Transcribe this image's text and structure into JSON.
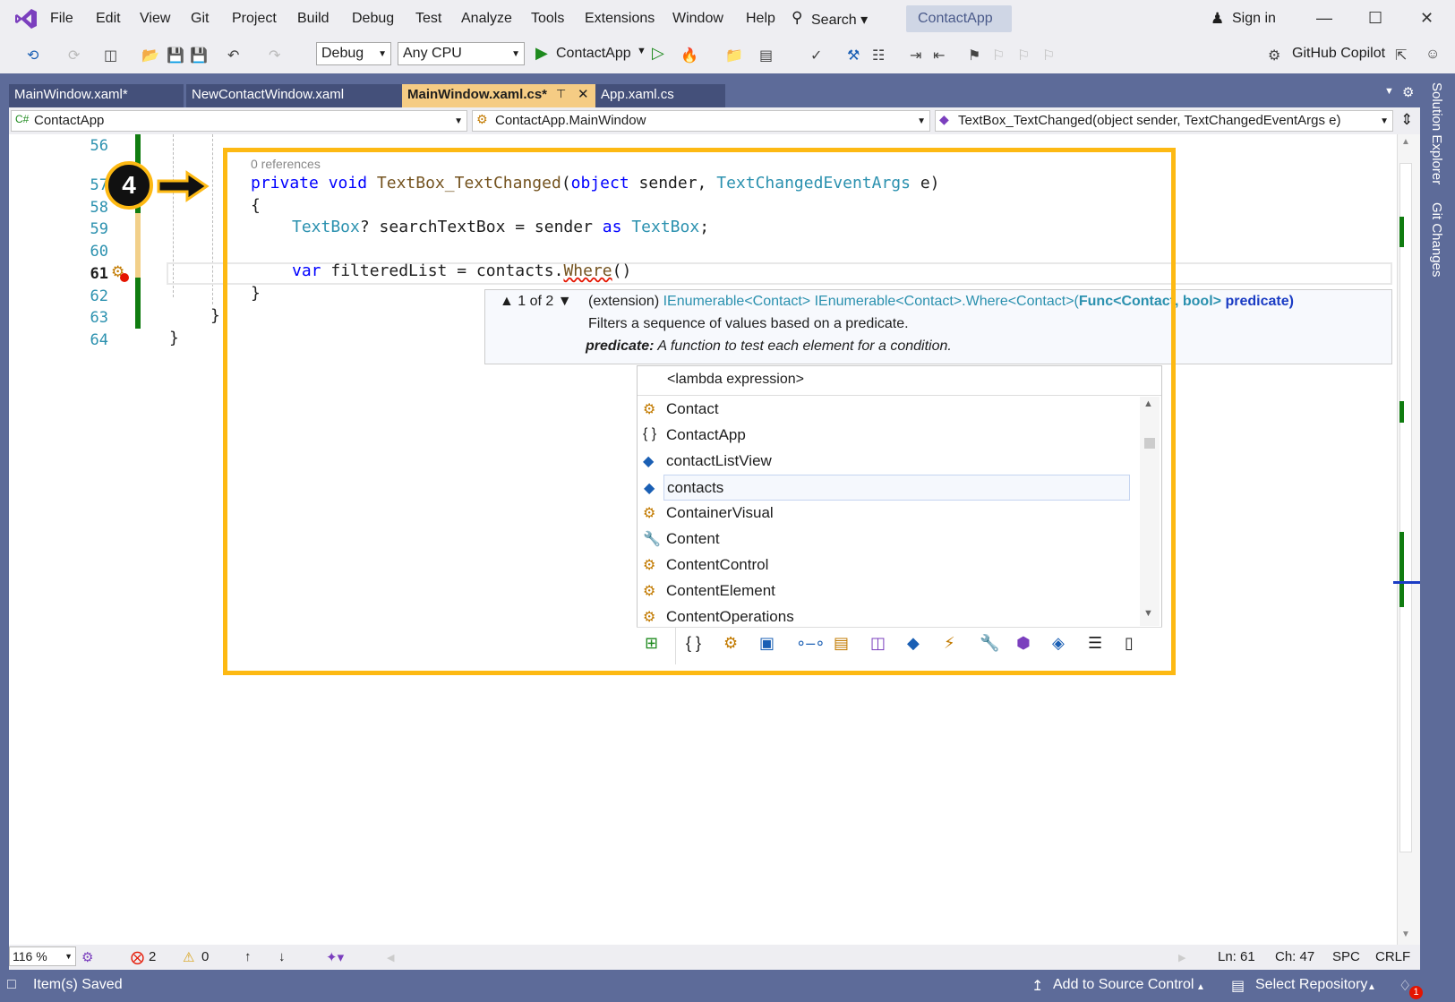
{
  "menu": [
    "File",
    "Edit",
    "View",
    "Git",
    "Project",
    "Build",
    "Debug",
    "Test",
    "Analyze",
    "Tools",
    "Extensions",
    "Window",
    "Help"
  ],
  "search_label": "Search",
  "app_title": "ContactApp",
  "sign_in": "Sign in",
  "toolbar": {
    "config": "Debug",
    "platform": "Any CPU",
    "start_label": "ContactApp",
    "copilot": "GitHub Copilot"
  },
  "tabs": [
    {
      "label": "MainWindow.xaml*"
    },
    {
      "label": "NewContactWindow.xaml"
    },
    {
      "label": "MainWindow.xaml.cs*"
    },
    {
      "label": "App.xaml.cs"
    }
  ],
  "side_tabs": [
    "Solution Explorer",
    "Git Changes"
  ],
  "navbar": {
    "project": "ContactApp",
    "class": "ContactApp.MainWindow",
    "member": "TextBox_TextChanged(object sender, TextChangedEventArgs e)"
  },
  "line_numbers": [
    "56",
    "57",
    "58",
    "59",
    "60",
    "61",
    "62",
    "63",
    "64"
  ],
  "codelens": "0 references",
  "code": {
    "l57": {
      "kw1": "private",
      "kw2": "void",
      "fn": "TextBox_TextChanged",
      "p1": "(",
      "kw3": "object",
      "p2": " sender, ",
      "ty": "TextChangedEventArgs",
      "p3": " e)"
    },
    "l58": "{",
    "l59": {
      "ty1": "TextBox",
      "q": "? searchTextBox = sender ",
      "kw": "as",
      "sp": " ",
      "ty2": "TextBox",
      "end": ";"
    },
    "l61": {
      "kw": "var",
      "rest": " filteredList = contacts.",
      "fn": "Where",
      "paren": "()"
    },
    "l62": "}",
    "l63": "}",
    "l64": "}"
  },
  "callout_number": "4",
  "quickinfo": {
    "overload": "1 of 2",
    "signature_pre": "(extension) ",
    "sig1": "IEnumerable",
    "sig2": "<Contact> ",
    "sig3": "IEnumerable",
    "sig4": "<Contact>.Where<Contact>(",
    "sig5": "Func<Contact, bool>",
    "sig6": " predicate)",
    "desc": "Filters a sequence of values based on a predicate.",
    "param_name": "predicate:",
    "param_desc": "A function to test each element for a condition."
  },
  "completion": {
    "header": "<lambda expression>",
    "items": [
      {
        "label": "Contact",
        "icon": "class-icon"
      },
      {
        "label": "ContactApp",
        "icon": "namespace-icon"
      },
      {
        "label": "contactListView",
        "icon": "field-icon"
      },
      {
        "label": "contacts",
        "icon": "field-icon"
      },
      {
        "label": "ContainerVisual",
        "icon": "class-icon"
      },
      {
        "label": "Content",
        "icon": "property-icon"
      },
      {
        "label": "ContentControl",
        "icon": "class-icon"
      },
      {
        "label": "ContentElement",
        "icon": "class-icon"
      },
      {
        "label": "ContentOperations",
        "icon": "class-icon"
      }
    ],
    "selected": "contacts"
  },
  "editor_status": {
    "zoom": "116 %",
    "errors": "2",
    "warnings": "0",
    "line": "Ln: 61",
    "col": "Ch: 47",
    "ws": "SPC",
    "eol": "CRLF"
  },
  "statusbar": {
    "left": "Item(s) Saved",
    "source_control": "Add to Source Control",
    "repo": "Select Repository",
    "notif": "1"
  }
}
